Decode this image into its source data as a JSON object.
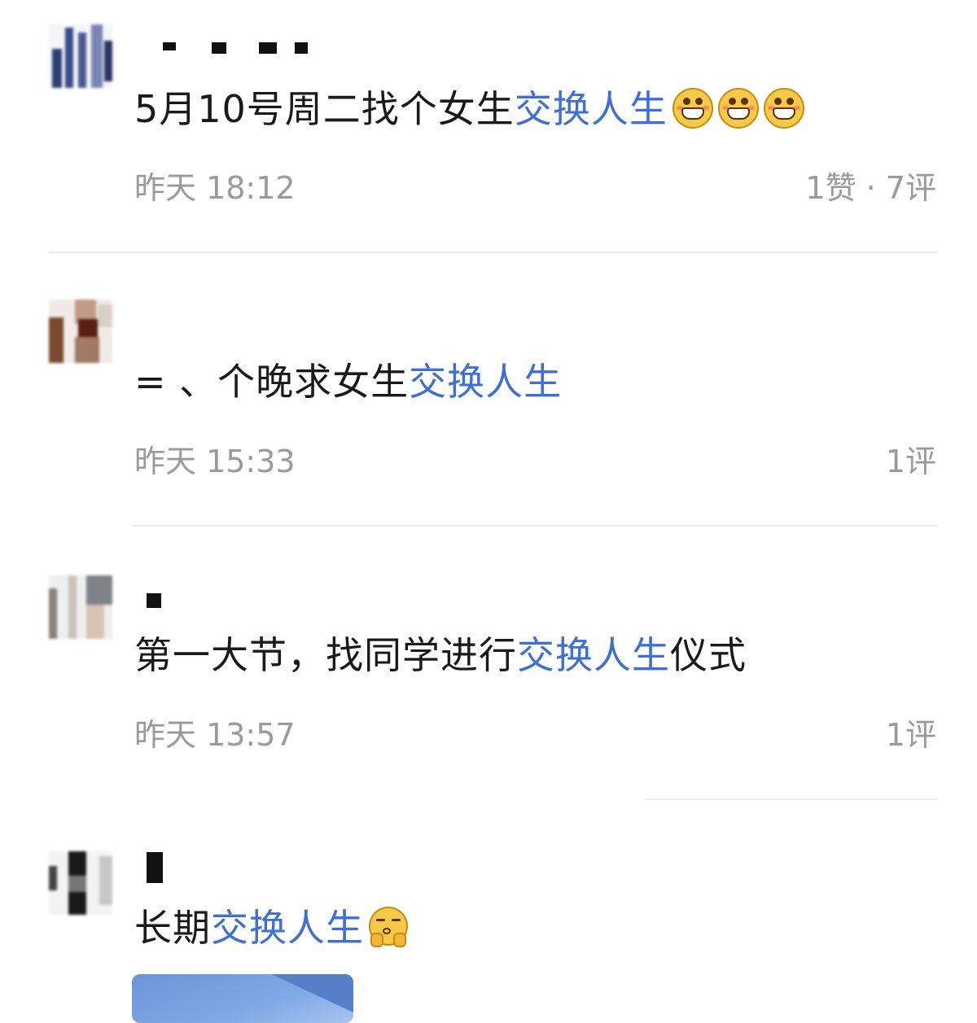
{
  "feed": {
    "posts": [
      {
        "text_prefix": "5月10号周二找个女生",
        "keyword": "交换人生",
        "text_suffix": "",
        "emojis": [
          "grinning-squint-emoji",
          "grinning-squint-emoji",
          "grinning-squint-emoji"
        ],
        "time": "昨天 18:12",
        "stats": "1赞 · 7评"
      },
      {
        "text_prefix": "=  、个晚求女生",
        "keyword": "交换人生",
        "text_suffix": "",
        "emojis": [],
        "time": "昨天 15:33",
        "stats": "1评"
      },
      {
        "text_prefix": "第一大节，找同学进行",
        "keyword": "交换人生",
        "text_suffix": "仪式",
        "emojis": [],
        "time": "昨天 13:57",
        "stats": "1评"
      },
      {
        "text_prefix": "长期",
        "keyword": "交换人生",
        "text_suffix": "",
        "emojis": [
          "hugging-face-emoji"
        ],
        "time": "",
        "stats": ""
      }
    ]
  },
  "colors": {
    "keyword": "#3d6fd6",
    "body_text": "#1a1a1a",
    "meta_text": "#9a9a9a",
    "divider": "#ececec",
    "background": "#ffffff"
  }
}
